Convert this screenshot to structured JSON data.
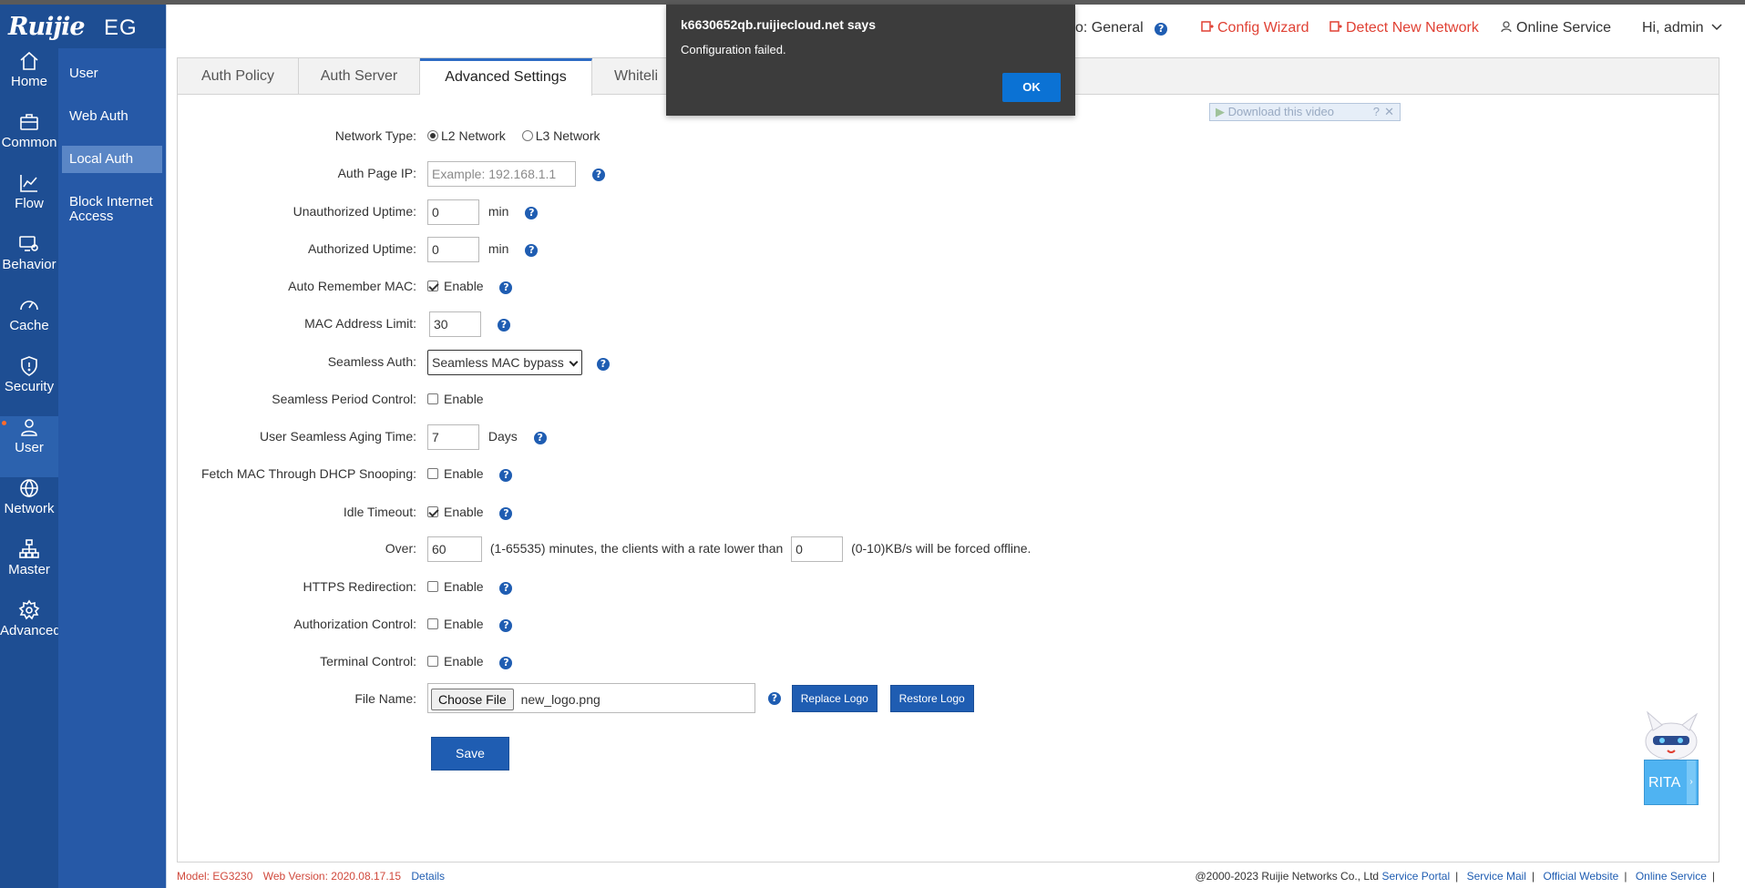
{
  "brand": {
    "logo": "Ruijie",
    "product": "EG"
  },
  "rail": [
    {
      "label": "Home",
      "icon": "home-icon"
    },
    {
      "label": "Common",
      "icon": "briefcase-icon"
    },
    {
      "label": "Flow",
      "icon": "line-chart-icon"
    },
    {
      "label": "Behavior",
      "icon": "monitor-gear-icon"
    },
    {
      "label": "Cache",
      "icon": "gauge-icon"
    },
    {
      "label": "Security",
      "icon": "shield-icon"
    },
    {
      "label": "User",
      "icon": "user-icon"
    },
    {
      "label": "Network",
      "icon": "globe-icon"
    },
    {
      "label": "Master",
      "icon": "topology-icon"
    },
    {
      "label": "Advanced",
      "icon": "gear-icon"
    }
  ],
  "submenu": [
    {
      "label": "User"
    },
    {
      "label": "Web Auth"
    },
    {
      "label": "Local Auth"
    },
    {
      "label": "Block Internet Access"
    }
  ],
  "header": {
    "mode_label": "o:  General",
    "config_wizard": "Config Wizard",
    "detect_network": "Detect New Network",
    "online_service": "Online Service",
    "greeting": "Hi, admin"
  },
  "tabs": [
    "Auth Policy",
    "Auth Server",
    "Advanced Settings",
    "Whiteli"
  ],
  "form": {
    "network_type": {
      "label": "Network Type:",
      "l2": "L2 Network",
      "l3": "L3 Network"
    },
    "auth_page_ip": {
      "label": "Auth Page IP:",
      "placeholder": "Example: 192.168.1.1"
    },
    "unauth_uptime": {
      "label": "Unauthorized Uptime:",
      "value": "0",
      "unit": "min"
    },
    "auth_uptime": {
      "label": "Authorized Uptime:",
      "value": "0",
      "unit": "min"
    },
    "auto_remember_mac": {
      "label": "Auto Remember MAC:",
      "option": "Enable"
    },
    "mac_limit": {
      "label": "MAC Address Limit:",
      "value": "30"
    },
    "seamless_auth": {
      "label": "Seamless Auth:",
      "value": "Seamless MAC bypass"
    },
    "seamless_period": {
      "label": "Seamless Period Control:",
      "option": "Enable"
    },
    "seamless_aging": {
      "label": "User Seamless Aging Time:",
      "value": "7",
      "unit": "Days"
    },
    "dhcp_snooping": {
      "label": "Fetch MAC Through DHCP Snooping:",
      "option": "Enable"
    },
    "idle_timeout": {
      "label": "Idle Timeout:",
      "option": "Enable"
    },
    "over": {
      "label": "Over:",
      "minutes": "60",
      "text1": "(1-65535) minutes, the clients with a rate lower than",
      "rate": "0",
      "text2": "(0-10)KB/s will be forced offline."
    },
    "https_redirect": {
      "label": "HTTPS Redirection:",
      "option": "Enable"
    },
    "auth_control": {
      "label": "Authorization Control:",
      "option": "Enable"
    },
    "terminal_control": {
      "label": "Terminal Control:",
      "option": "Enable"
    },
    "file_name": {
      "label": "File Name:",
      "choose": "Choose File",
      "file": "new_logo.png",
      "replace": "Replace Logo",
      "restore": "Restore Logo"
    },
    "save": "Save"
  },
  "video": {
    "label": "Download this video"
  },
  "dialog": {
    "title": "k6630652qb.ruijiecloud.net says",
    "message": "Configuration failed.",
    "ok": "OK"
  },
  "footer": {
    "model_label": "Model:",
    "model": "EG3230",
    "web_version_label": "Web Version:",
    "web_version": "2020.08.17.15",
    "details": "Details",
    "copyright": "@2000-2023 Ruijie Networks Co., Ltd",
    "links": [
      "Service Portal",
      "Service Mail",
      "Official Website",
      "Online Service"
    ]
  },
  "assistant": {
    "label": "RITA"
  },
  "colors": {
    "rail": "#1e4e93",
    "submenu": "#2659a7",
    "accent": "#1f5db2",
    "header_red": "#e04134",
    "dialog": "#3c3c3c",
    "ok_button": "#0b72d4"
  }
}
